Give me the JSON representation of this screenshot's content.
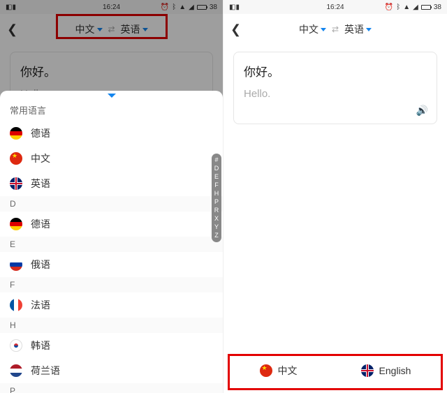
{
  "status": {
    "time": "16:24",
    "battery": "38"
  },
  "header": {
    "source": "中文",
    "target": "英语"
  },
  "translation": {
    "source": "你好。",
    "target": "Hello."
  },
  "sheet": {
    "section_label": "常用语言",
    "frequent": [
      {
        "flag": "de",
        "label": "德语"
      },
      {
        "flag": "cn",
        "label": "中文"
      },
      {
        "flag": "gb",
        "label": "英语"
      }
    ],
    "groups": [
      {
        "letter": "D",
        "items": [
          {
            "flag": "de",
            "label": "德语"
          }
        ]
      },
      {
        "letter": "E",
        "items": [
          {
            "flag": "ru",
            "label": "俄语"
          }
        ]
      },
      {
        "letter": "F",
        "items": [
          {
            "flag": "fr",
            "label": "法语"
          }
        ]
      },
      {
        "letter": "H",
        "items": [
          {
            "flag": "kr",
            "label": "韩语"
          },
          {
            "flag": "nl",
            "label": "荷兰语"
          }
        ]
      },
      {
        "letter": "P",
        "items": []
      }
    ],
    "index": [
      "#",
      "D",
      "E",
      "F",
      "H",
      "P",
      "R",
      "X",
      "Y",
      "Z"
    ]
  },
  "bottom": {
    "leftLabel": "中文",
    "rightLabel": "English"
  }
}
